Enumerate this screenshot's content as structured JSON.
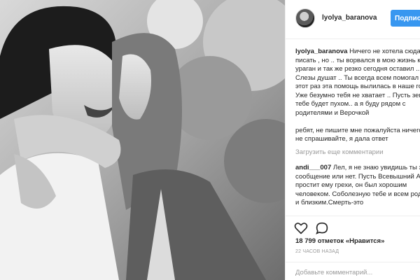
{
  "photo": {
    "description_icon": "photo"
  },
  "header": {
    "username": "lyolya_baranova",
    "follow_label": "Подписаться"
  },
  "caption": {
    "username": "lyolya_baranova",
    "text": " Ничего не хотела сюда писать , но .. ты ворвался в мою жизнь как ураган и так же резко сегодня оставил .. Слезы душат .. Ты всегда всем помогал , а в этот раз эта помощь вылилась в наше горе.\nУже безумно тебя не хватает .. Пусть земля тебе будет пухом.. а я буду рядом с родителями и Верочкой\n\nребят, не пишите мне пожалуйста ничего и не спрашивайте, я дала ответ"
  },
  "load_more": "Загрузить еще комментарии",
  "comment": {
    "username": "andi___007",
    "text": " Лел, я не знаю увидишь ты это сообщение или нет. Пусть Всевышний Аллах простит ему грехи, он был хорошим человеком. Соболезную тебе и всем родным и близким.Смерть-это"
  },
  "actions": {
    "like_icon": "heart-icon",
    "comment_icon": "comment-icon"
  },
  "likes": "18 799 отметок «Нравится»",
  "time": "22 часов назад",
  "add_comment": {
    "placeholder": "Добавьте комментарий..."
  }
}
